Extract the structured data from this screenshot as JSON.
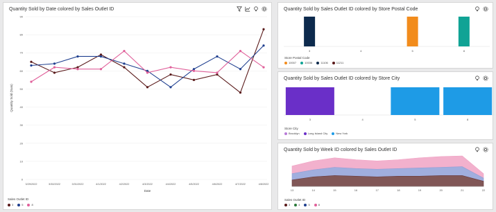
{
  "charts": [
    {
      "title": "Quantity Sold by Date colored by Sales Outlet ID",
      "icons": [
        "filter-icon",
        "chart-type-icon",
        "bulb-icon",
        "settings-icon"
      ],
      "legend_title": "Sales Outlet ID",
      "legend": [
        {
          "label": "3",
          "color": "#5a1a1a"
        },
        {
          "label": "5",
          "color": "#1f3f8f"
        },
        {
          "label": "8",
          "color": "#e0609a"
        }
      ],
      "chart_data": {
        "type": "line",
        "xlabel": "Date",
        "ylabel": "Quantity Sold (Sum)",
        "ylim": [
          0,
          90
        ],
        "yticks": [
          0,
          10,
          20,
          30,
          40,
          50,
          60,
          70,
          80,
          90
        ],
        "categories": [
          "3/29/2022",
          "3/30/2022",
          "3/31/2022",
          "4/1/2022",
          "4/2/2022",
          "4/3/2022",
          "4/4/2022",
          "4/5/2022",
          "4/6/2022",
          "4/7/2022",
          "4/8/2022"
        ],
        "tick_labels": [
          "3/29/2022",
          "3/30/2022",
          "3/31/2022",
          "4/1/2022",
          "4/2/2022",
          "4/3/2022",
          "4/4/2022",
          "4/5/2022",
          "4/6/2022",
          "4/7/2022",
          "4/8/2022"
        ],
        "series": [
          {
            "name": "3",
            "color": "#5a1a1a",
            "values": [
              65,
              59,
              62,
              69,
              62,
              51,
              58,
              55,
              58,
              48,
              83
            ]
          },
          {
            "name": "5",
            "color": "#1f3f8f",
            "values": [
              63,
              64,
              68,
              68,
              64,
              60,
              51,
              61,
              68,
              61,
              74
            ]
          },
          {
            "name": "8",
            "color": "#e0609a",
            "values": [
              54,
              62,
              61,
              61,
              71,
              59,
              62,
              60,
              59,
              71,
              62
            ]
          }
        ]
      }
    },
    {
      "title": "Quantity Sold by Sales Outlet ID colored by Store Postal Code",
      "icons": [
        "bulb-icon",
        "settings-icon"
      ],
      "legend_title": "Store Postal Code",
      "legend": [
        {
          "label": "10007",
          "color": "#f28c1c"
        },
        {
          "label": "10036",
          "color": "#10a395"
        },
        {
          "label": "11106",
          "color": "#0d2a4d"
        },
        {
          "label": "11211",
          "color": "#5a1a1a"
        }
      ],
      "chart_data": {
        "type": "bar",
        "categories": [
          "3",
          "4",
          "5",
          "8"
        ],
        "series": [
          {
            "name": "11106",
            "color": "#0d2a4d",
            "values": [
              1,
              0,
              0,
              0
            ]
          },
          {
            "name": "10007",
            "color": "#f28c1c",
            "values": [
              0,
              0,
              1,
              0
            ]
          },
          {
            "name": "10036",
            "color": "#10a395",
            "values": [
              0,
              0,
              0,
              1
            ]
          }
        ]
      }
    },
    {
      "title": "Quantity Sold by Sales Outlet ID colored by Store City",
      "icons": [
        "bulb-icon",
        "settings-icon"
      ],
      "legend_title": "Store City",
      "legend": [
        {
          "label": "Brooklyn",
          "color": "#b87ad8"
        },
        {
          "label": "Long Island City",
          "color": "#6a2fc8"
        },
        {
          "label": "New York",
          "color": "#1e9be6"
        }
      ],
      "chart_data": {
        "type": "bar",
        "categories": [
          "3",
          "4",
          "5",
          "8"
        ],
        "series": [
          {
            "name": "Long Island City",
            "color": "#6a2fc8",
            "values": [
              1,
              0,
              0,
              0
            ]
          },
          {
            "name": "New York",
            "color": "#1e9be6",
            "values": [
              0,
              0,
              1,
              1
            ]
          }
        ]
      }
    },
    {
      "title": "Quantity Sold by Week ID colored by Sales Outlet ID",
      "icons": [
        "bulb-icon",
        "settings-icon"
      ],
      "legend_title": "Sales Outlet ID",
      "legend": [
        {
          "label": "3",
          "color": "#5a1a1a"
        },
        {
          "label": "4",
          "color": "#2a7a3a"
        },
        {
          "label": "5",
          "color": "#1f3f8f"
        },
        {
          "label": "8",
          "color": "#e0609a"
        }
      ],
      "chart_data": {
        "type": "area",
        "categories": [
          "13",
          "14",
          "15",
          "16",
          "17",
          "18",
          "19",
          "20",
          "21",
          "22"
        ],
        "series": [
          {
            "name": "3",
            "color": "#6b3a3a",
            "values": [
              10,
              15,
              17,
              16,
              15,
              16,
              16,
              17,
              17,
              8
            ]
          },
          {
            "name": "5",
            "color": "#8fa0d8",
            "values": [
              10,
              11,
              13,
              12,
              12,
              12,
              13,
              13,
              14,
              5
            ]
          },
          {
            "name": "8",
            "color": "#f0a3c4",
            "values": [
              12,
              14,
              15,
              14,
              13,
              14,
              16,
              17,
              17,
              7
            ]
          }
        ]
      }
    }
  ]
}
